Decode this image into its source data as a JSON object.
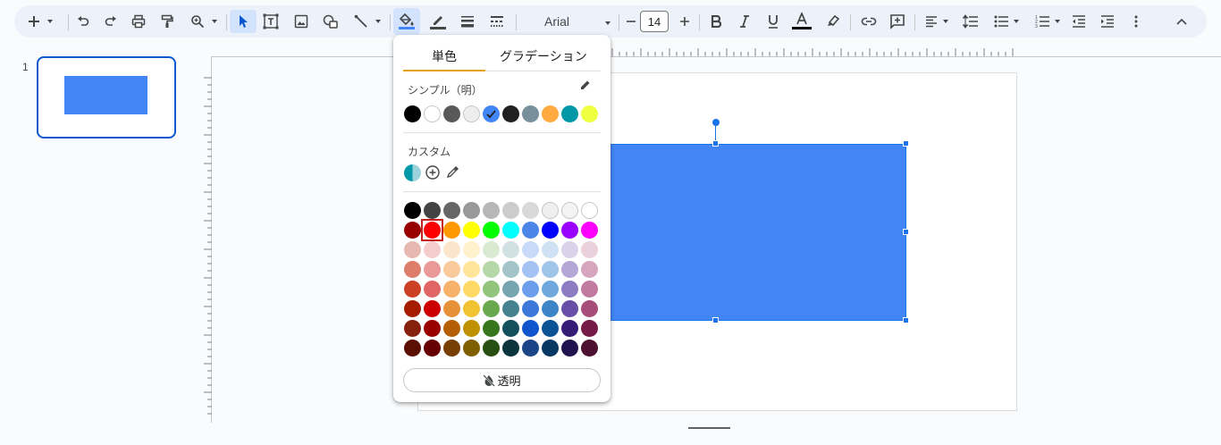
{
  "toolbar": {
    "font_name": "Arial",
    "font_size": "14",
    "fill_color": "#4285f4"
  },
  "slides": [
    {
      "number": "1"
    }
  ],
  "fill_popup": {
    "tabs": [
      "単色",
      "グラデーション"
    ],
    "simple_label": "シンプル（明）",
    "custom_label": "カスタム",
    "transparent_label": "透明",
    "simple_colors": [
      "#000000",
      "#ffffff",
      "#595959",
      "#eeeeee",
      "#4285f4",
      "#212121",
      "#78909c",
      "#ffab40",
      "#0097a7",
      "#eeff41"
    ],
    "simple_selected": 4,
    "grid_selected": [
      1,
      1
    ],
    "grid_colors": [
      [
        "#000000",
        "#434343",
        "#666666",
        "#999999",
        "#b7b7b7",
        "#cccccc",
        "#d9d9d9",
        "#efefef",
        "#f3f3f3",
        "#ffffff"
      ],
      [
        "#980000",
        "#ff0000",
        "#ff9900",
        "#ffff00",
        "#00ff00",
        "#00ffff",
        "#4a86e8",
        "#0000ff",
        "#9900ff",
        "#ff00ff"
      ],
      [
        "#e6b8af",
        "#f4cccc",
        "#fce5cd",
        "#fff2cc",
        "#d9ead3",
        "#d0e0e3",
        "#c9daf8",
        "#cfe2f3",
        "#d9d2e9",
        "#ead1dc"
      ],
      [
        "#dd7e6b",
        "#ea9999",
        "#f9cb9c",
        "#ffe599",
        "#b6d7a8",
        "#a2c4c9",
        "#a4c2f4",
        "#9fc5e8",
        "#b4a7d6",
        "#d5a6bd"
      ],
      [
        "#cc4125",
        "#e06666",
        "#f6b26b",
        "#ffd966",
        "#93c47d",
        "#76a5af",
        "#6d9eeb",
        "#6fa8dc",
        "#8e7cc3",
        "#c27ba0"
      ],
      [
        "#a61c00",
        "#cc0000",
        "#e69138",
        "#f1c232",
        "#6aa84f",
        "#45818e",
        "#3c78d8",
        "#3d85c6",
        "#674ea7",
        "#a64d79"
      ],
      [
        "#85200c",
        "#990000",
        "#b45f06",
        "#bf9000",
        "#38761d",
        "#134f5c",
        "#1155cc",
        "#0b5394",
        "#351c75",
        "#741b47"
      ],
      [
        "#5b0f00",
        "#660000",
        "#783f04",
        "#7f6000",
        "#274e13",
        "#0c343d",
        "#1c4587",
        "#073763",
        "#20124d",
        "#4c1130"
      ]
    ]
  }
}
